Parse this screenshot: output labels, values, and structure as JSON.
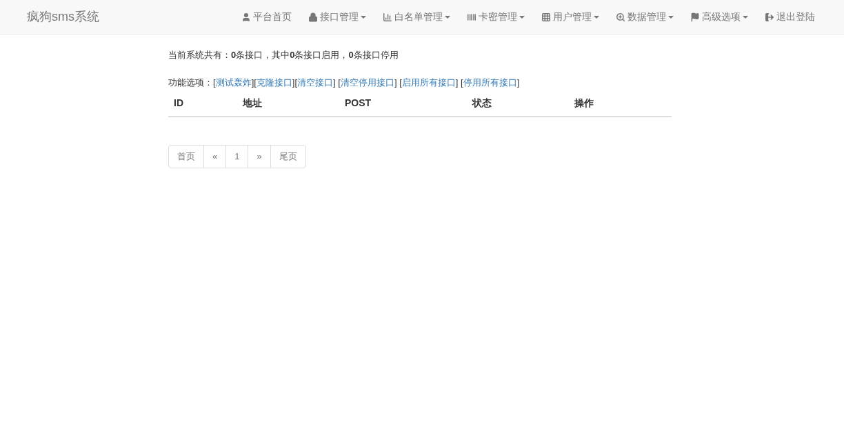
{
  "navbar": {
    "brand": "疯狗sms系统",
    "items": [
      {
        "label": "平台首页",
        "dropdown": false
      },
      {
        "label": "接口管理",
        "dropdown": true
      },
      {
        "label": "白名单管理",
        "dropdown": true
      },
      {
        "label": "卡密管理",
        "dropdown": true
      },
      {
        "label": "用户管理",
        "dropdown": true
      },
      {
        "label": "数据管理",
        "dropdown": true
      },
      {
        "label": "高级选项",
        "dropdown": true
      },
      {
        "label": "退出登陆",
        "dropdown": false
      }
    ]
  },
  "summary": "当前系统共有：**0**条接口，其中**0**条接口启用，**0**条接口停用",
  "options": [
    {
      "kind": "text",
      "text": "功能选项：["
    },
    {
      "kind": "link",
      "text": "测试轰炸"
    },
    {
      "kind": "text",
      "text": "]["
    },
    {
      "kind": "link",
      "text": "克隆接口"
    },
    {
      "kind": "text",
      "text": "]["
    },
    {
      "kind": "link",
      "text": "清空接口"
    },
    {
      "kind": "text",
      "text": "] ["
    },
    {
      "kind": "link",
      "text": "清空停用接口"
    },
    {
      "kind": "text",
      "text": "] ["
    },
    {
      "kind": "link",
      "text": "启用所有接口"
    },
    {
      "kind": "text",
      "text": "] ["
    },
    {
      "kind": "link",
      "text": "停用所有接口"
    },
    {
      "kind": "text",
      "text": "]"
    }
  ],
  "table": {
    "columns": [
      "ID",
      "地址",
      "POST",
      "状态",
      "操作"
    ]
  },
  "pagination": [
    "首页",
    "«",
    "1",
    "»",
    "尾页"
  ]
}
